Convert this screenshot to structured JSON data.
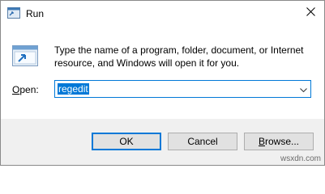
{
  "window": {
    "title": "Run",
    "description_line1": "Type the name of a program, folder, document, or Internet",
    "description_line2": "resource, and Windows will open it for you.",
    "open_label_prefix": "",
    "open_label_accel": "O",
    "open_label_rest": "pen:",
    "open_value": "regedit",
    "buttons": {
      "ok": "OK",
      "cancel": "Cancel",
      "browse_accel": "B",
      "browse_rest": "rowse..."
    },
    "watermark": "wsxdn.com"
  },
  "colors": {
    "accent": "#0078d7",
    "button_bar": "#f0f0f0",
    "button_face": "#e1e1e1"
  },
  "icons": [
    "run-app-icon",
    "close-icon",
    "run-dialog-icon",
    "chevron-down-icon"
  ]
}
